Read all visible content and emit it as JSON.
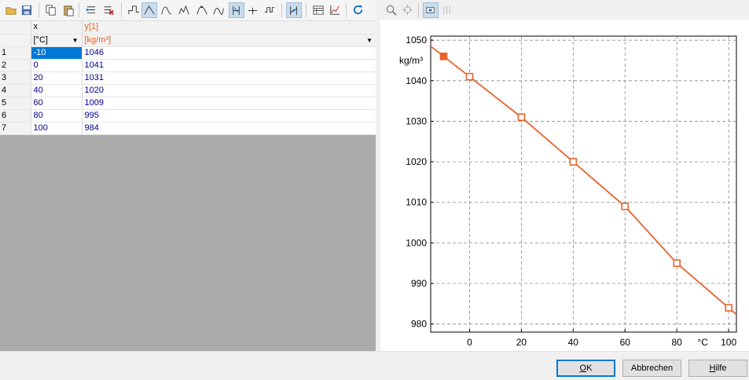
{
  "toolbar_left": [
    {
      "icon": "open-folder-icon"
    },
    {
      "icon": "save-icon"
    },
    {
      "icon": "copy-icon"
    },
    {
      "icon": "paste-icon"
    },
    {
      "icon": "insert-row-icon"
    },
    {
      "icon": "delete-row-icon"
    },
    {
      "icon": "step-interpolation-icon"
    },
    {
      "icon": "linear-interpolation-icon",
      "active": true
    },
    {
      "icon": "spline-interpolation-icon"
    },
    {
      "icon": "akima-interpolation-icon"
    },
    {
      "icon": "pchip-interpolation-icon"
    },
    {
      "icon": "smooth-interpolation-icon"
    },
    {
      "icon": "hold-extrapolation-icon",
      "active": true
    },
    {
      "icon": "linear-extrapolation-icon"
    },
    {
      "icon": "periodic-extrapolation-icon"
    },
    {
      "icon": "show-points-icon",
      "active": true
    },
    {
      "icon": "table-properties-icon"
    },
    {
      "icon": "plot-icon"
    },
    {
      "icon": "reset-icon"
    }
  ],
  "table": {
    "columns": [
      {
        "name": "x",
        "unit": "[°C]"
      },
      {
        "name": "y[1]",
        "unit": "[kg/m³]"
      }
    ],
    "rows": [
      {
        "n": "1",
        "x": "-10",
        "y": "1046"
      },
      {
        "n": "2",
        "x": "0",
        "y": "1041"
      },
      {
        "n": "3",
        "x": "20",
        "y": "1031"
      },
      {
        "n": "4",
        "x": "40",
        "y": "1020"
      },
      {
        "n": "5",
        "x": "60",
        "y": "1009"
      },
      {
        "n": "6",
        "x": "80",
        "y": "995"
      },
      {
        "n": "7",
        "x": "100",
        "y": "984"
      }
    ]
  },
  "chart_toolbar": [
    {
      "icon": "zoom-icon"
    },
    {
      "icon": "pan-icon"
    },
    {
      "icon": "point-select-icon",
      "active": true
    },
    {
      "icon": "range-select-icon"
    }
  ],
  "chart_data": {
    "type": "line",
    "x": [
      -10,
      0,
      20,
      40,
      60,
      80,
      100
    ],
    "series": [
      {
        "values": [
          1046,
          1041,
          1031,
          1020,
          1009,
          995,
          984
        ]
      }
    ],
    "selected_index": 0,
    "xlim": [
      -15,
      103
    ],
    "ylim": [
      978,
      1051
    ],
    "xticks": [
      0,
      20,
      40,
      60,
      80,
      100
    ],
    "yticks": [
      980,
      990,
      1000,
      1010,
      1020,
      1030,
      1040,
      1050
    ],
    "xunit": "°C",
    "yunit": "kg/m³",
    "grid": true,
    "color": "#e8632a"
  },
  "buttons": {
    "ok_mnemonic": "O",
    "ok_rest": "K",
    "cancel": "Abbrechen",
    "help_mnemonic": "H",
    "help_rest": "ilfe"
  }
}
